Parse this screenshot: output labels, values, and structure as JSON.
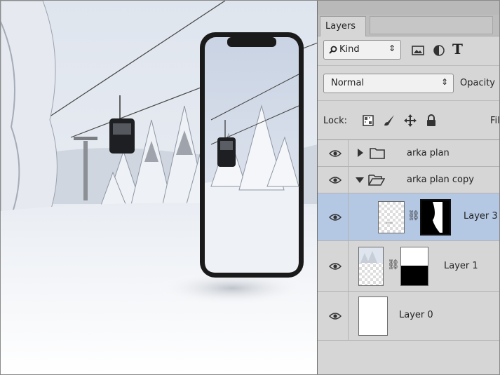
{
  "panel": {
    "tab_label": "Layers",
    "filter": {
      "kind_label": "Kind",
      "icons": [
        "search-icon",
        "image-filter-icon",
        "adjustment-filter-icon",
        "type-filter-icon"
      ],
      "type_glyph": "T"
    },
    "blend": {
      "mode": "Normal",
      "opacity_label": "Opacity"
    },
    "lock": {
      "label": "Lock:",
      "icons": [
        "lock-transparent-icon",
        "lock-image-icon",
        "lock-position-icon",
        "lock-all-icon"
      ],
      "fill_label": "Fil"
    },
    "layers": [
      {
        "name": "arka plan",
        "type": "group",
        "expanded": false,
        "visible": true
      },
      {
        "name": "arka plan copy",
        "type": "group",
        "expanded": true,
        "visible": true
      },
      {
        "name": "Layer 3",
        "type": "masked-layer",
        "visible": true,
        "selected": true
      },
      {
        "name": "Layer 1",
        "type": "masked-layer",
        "visible": true
      },
      {
        "name": "Layer 0",
        "type": "layer",
        "visible": true
      }
    ]
  },
  "colors": {
    "selected_row": "#b4c7e3",
    "panel_bg": "#d6d6d6"
  }
}
